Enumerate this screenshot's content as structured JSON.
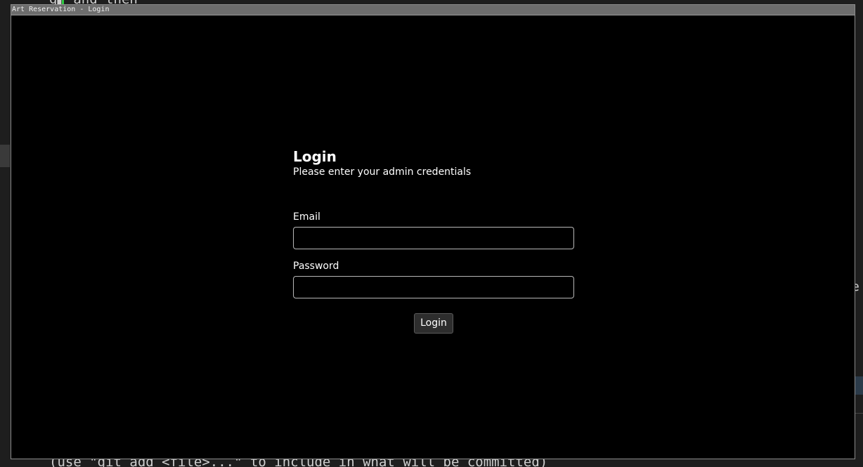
{
  "background": {
    "terminal_top_text": "g▌ and then",
    "terminal_bottom_text": "(use \"git add <file>...\" to include in what will be committed)",
    "terminal_right_text": "e"
  },
  "window": {
    "title": "Art Reservation - Login"
  },
  "login": {
    "heading": "Login",
    "subtitle": "Please enter your admin credentials",
    "email_label": "Email",
    "email_value": "",
    "password_label": "Password",
    "password_value": "",
    "submit_label": "Login"
  }
}
